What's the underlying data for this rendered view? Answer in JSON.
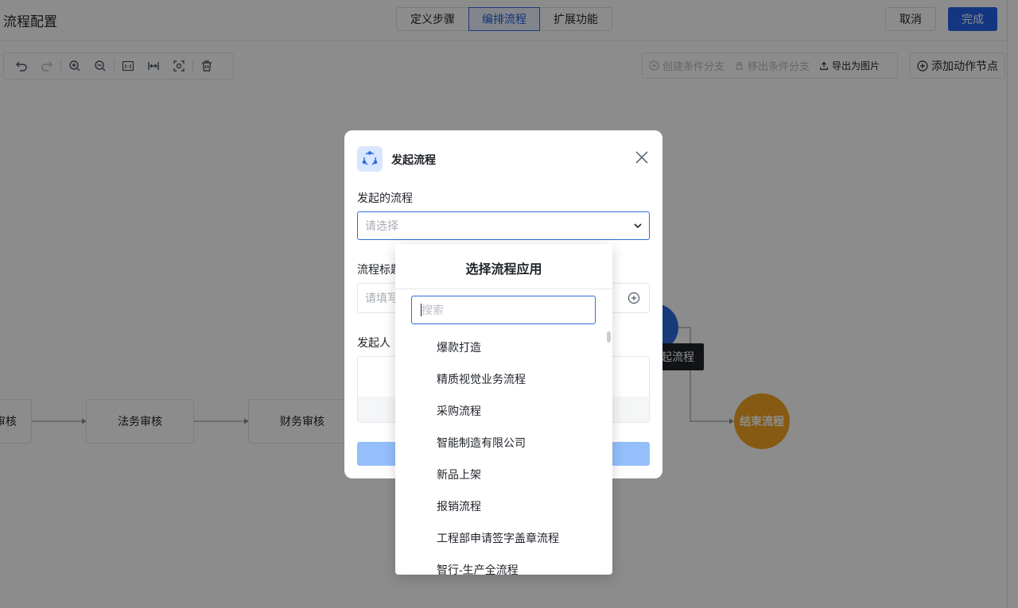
{
  "header": {
    "title": "流程配置",
    "tabs": [
      {
        "label": "定义步骤",
        "active": false
      },
      {
        "label": "编排流程",
        "active": true
      },
      {
        "label": "扩展功能",
        "active": false
      }
    ],
    "cancel_label": "取消",
    "done_label": "完成",
    "accent_color": "#2563eb"
  },
  "toolbar": {
    "tools": [
      "undo-icon",
      "redo-icon",
      "zoom-in-icon",
      "zoom-out-icon",
      "actual-size-icon",
      "fit-width-icon",
      "fit-view-icon",
      "delete-icon"
    ],
    "create_branch_label": "创建条件分支",
    "remove_branch_label": "移出条件分支",
    "export_label": "导出为图片",
    "add_action_label": "添加动作节点"
  },
  "canvas": {
    "nodes": {
      "partial_label": "审核",
      "legal_label": "法务审核",
      "finance_label": "财务审核",
      "launch_label": "起流程",
      "end_label": "结束流程"
    },
    "end_color": "#f5a524"
  },
  "modal": {
    "title": "发起流程",
    "process_label": "发起的流程",
    "process_placeholder": "请选择",
    "title_label": "流程标题",
    "title_placeholder": "请填写",
    "initiator_label": "发起人"
  },
  "dropdown": {
    "title": "选择流程应用",
    "search_placeholder": "搜索",
    "items": [
      "爆款打造",
      "精质视觉业务流程",
      "采购流程",
      "智能制造有限公司",
      "新品上架",
      "报销流程",
      "工程部申请签字盖章流程",
      "智行-生产全流程"
    ]
  }
}
